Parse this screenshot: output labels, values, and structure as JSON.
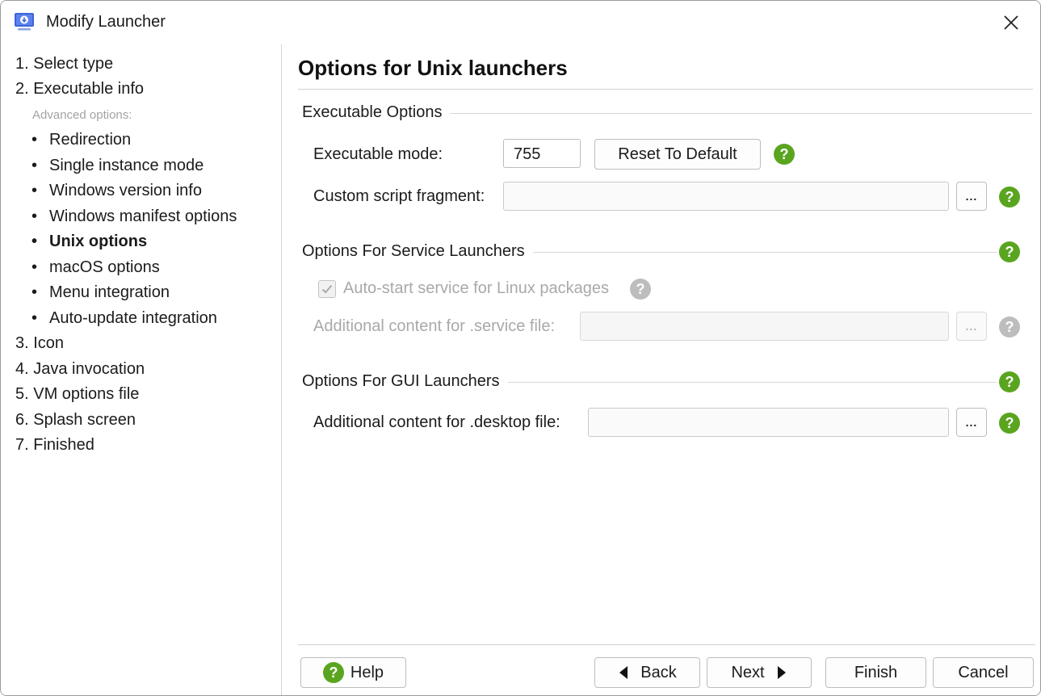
{
  "window": {
    "title": "Modify Launcher"
  },
  "sidebar": {
    "steps_top": [
      "1. Select type",
      "2. Executable info"
    ],
    "advanced_label": "Advanced options:",
    "sub_items": [
      "Redirection",
      "Single instance mode",
      "Windows version info",
      "Windows manifest options",
      "Unix options",
      "macOS options",
      "Menu integration",
      "Auto-update integration"
    ],
    "active_sub": "Unix options",
    "steps_bottom": [
      "3. Icon",
      "4. Java invocation",
      "5. VM options file",
      "6. Splash screen",
      "7. Finished"
    ]
  },
  "content": {
    "title": "Options for Unix launchers",
    "exec_section": {
      "title": "Executable Options",
      "mode_label": "Executable mode:",
      "mode_value": "755",
      "reset_label": "Reset To Default",
      "script_label": "Custom script fragment:",
      "script_value": ""
    },
    "service_section": {
      "title": "Options For Service Launchers",
      "autostart_label": "Auto-start service for Linux packages",
      "autostart_checked": true,
      "service_file_label": "Additional content for .service file:",
      "service_file_value": ""
    },
    "gui_section": {
      "title": "Options For GUI Launchers",
      "desktop_label": "Additional content for .desktop file:",
      "desktop_value": ""
    },
    "browse_label": "..."
  },
  "buttons": {
    "help": "Help",
    "back": "Back",
    "next": "Next",
    "finish": "Finish",
    "cancel": "Cancel"
  },
  "colors": {
    "help_green": "#5aa51f",
    "help_disabled": "#bdbdbd",
    "app_icon_blue": "#3f64d8"
  }
}
